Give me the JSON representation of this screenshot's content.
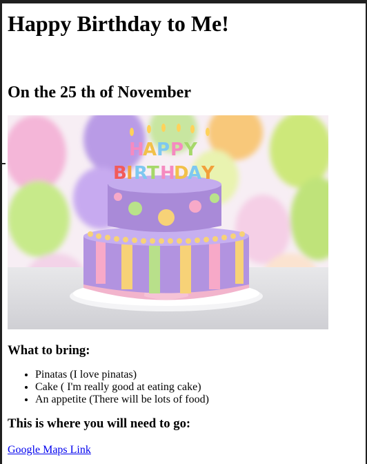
{
  "page": {
    "title": "Happy Birthday to Me!",
    "subtitle": "On the 25 th of November",
    "image_alt": "Birthday cake with HAPPY BIRTHDAY candles"
  },
  "bring": {
    "heading": "What to bring:",
    "items": [
      "Pinatas (I love pinatas)",
      "Cake ( I'm really good at eating cake)",
      "An appetite (There will be lots of food)"
    ]
  },
  "location": {
    "heading": "This is where you will need to go:",
    "link_label": "Google Maps Link"
  },
  "colors": {
    "link": "#0000ee",
    "frame": "#202020"
  },
  "icons": [
    "birthday-cake-image"
  ]
}
